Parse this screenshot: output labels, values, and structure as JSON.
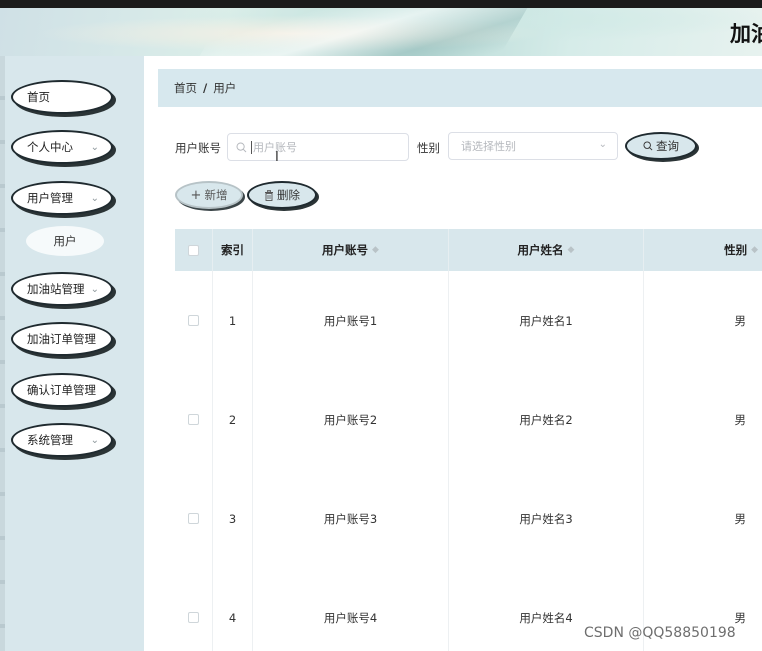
{
  "header": {
    "site_title": "加油"
  },
  "sidebar": {
    "items": [
      {
        "label": "首页",
        "has_arrow": false
      },
      {
        "label": "个人中心",
        "has_arrow": true
      },
      {
        "label": "用户管理",
        "has_arrow": true
      },
      {
        "label": "加油站管理",
        "has_arrow": true
      },
      {
        "label": "加油订单管理",
        "has_arrow": false
      },
      {
        "label": "确认订单管理",
        "has_arrow": false
      },
      {
        "label": "系统管理",
        "has_arrow": true
      }
    ],
    "submenu_label": "用户"
  },
  "breadcrumb": {
    "home": "首页",
    "separator": "/",
    "current": "用户"
  },
  "search": {
    "account_label": "用户账号",
    "account_placeholder": "用户账号",
    "gender_label": "性别",
    "gender_placeholder": "请选择性别",
    "query_button": "查询"
  },
  "actions": {
    "add_button": "新增",
    "delete_button": "删除"
  },
  "table": {
    "columns": [
      "索引",
      "用户账号",
      "用户姓名",
      "性别"
    ],
    "rows": [
      {
        "index": "1",
        "account": "用户账号1",
        "name": "用户姓名1",
        "gender": "男"
      },
      {
        "index": "2",
        "account": "用户账号2",
        "name": "用户姓名2",
        "gender": "男"
      },
      {
        "index": "3",
        "account": "用户账号3",
        "name": "用户姓名3",
        "gender": "男"
      },
      {
        "index": "4",
        "account": "用户账号4",
        "name": "用户姓名4",
        "gender": "男"
      }
    ]
  },
  "watermark": "CSDN @QQ58850198"
}
